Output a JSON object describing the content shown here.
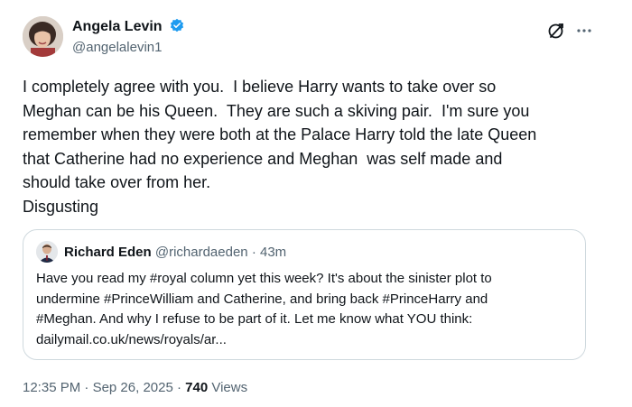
{
  "author": {
    "name": "Angela Levin",
    "handle": "@angelalevin1",
    "verified_color": "#1d9bf0"
  },
  "tweet": {
    "lines": [
      "I completely agree with you.  I believe Harry wants to take over so",
      "Meghan can be his Queen.  They are such a skiving pair.  I'm sure you",
      "remember when they were both at the Palace Harry told the late Queen",
      "that Catherine had no experience and Meghan  was self made and",
      "should take over from her.",
      "Disgusting"
    ]
  },
  "quote": {
    "name": "Richard Eden",
    "handle": "@richardaeden",
    "separator": "·",
    "time": "43m",
    "lines": [
      "Have you read my #royal column yet this week? It's about the sinister plot to",
      "undermine #PrinceWilliam and Catherine, and bring back #PrinceHarry and",
      "#Meghan. And why I refuse to be part of it. Let me know what YOU think:",
      "dailymail.co.uk/news/royals/ar..."
    ]
  },
  "meta": {
    "time": "12:35 PM",
    "sep1": "·",
    "date": "Sep 26, 2025",
    "sep2": "·",
    "views_count": "740",
    "views_label": "Views"
  },
  "icons": {
    "grok": "grok-icon",
    "more": "more-icon",
    "verified": "verified-badge-icon"
  }
}
